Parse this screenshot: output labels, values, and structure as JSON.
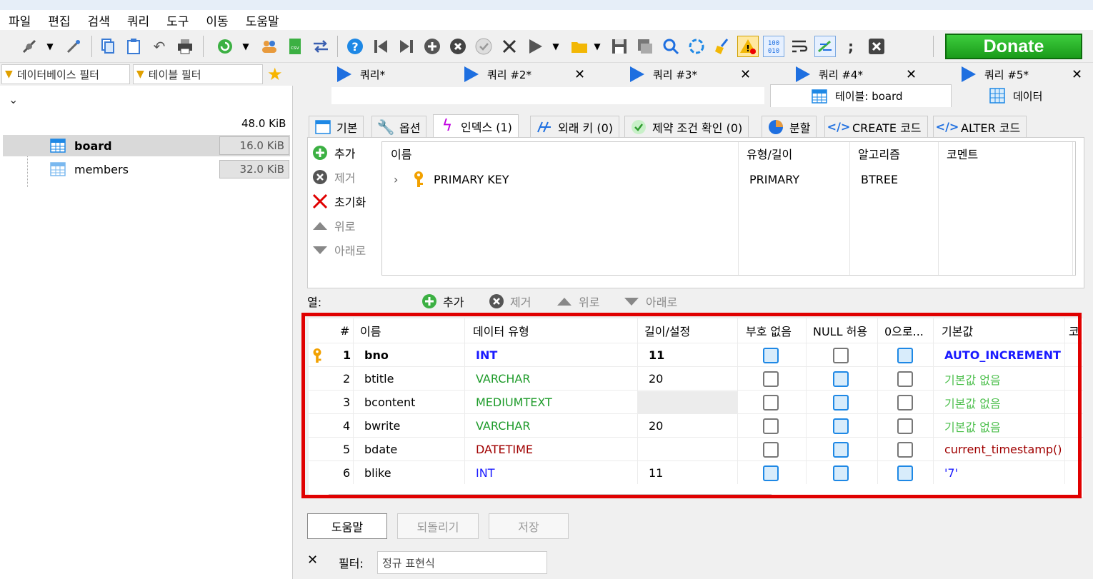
{
  "menu": [
    "파일",
    "편집",
    "검색",
    "쿼리",
    "도구",
    "이동",
    "도움말"
  ],
  "donate_label": "Donate",
  "left": {
    "db_filter_placeholder": "데이터베이스 필터",
    "table_filter_placeholder": "테이블 필터",
    "total_size": "48.0 KiB",
    "tables": [
      {
        "name": "board",
        "size": "16.0 KiB",
        "selected": true
      },
      {
        "name": "members",
        "size": "32.0 KiB",
        "selected": false
      }
    ]
  },
  "query_tabs": [
    "쿼리*",
    "쿼리 #2*",
    "쿼리 #3*",
    "쿼리 #4*",
    "쿼리 #5*"
  ],
  "sub_tabs": {
    "table": "테이블: board",
    "data": "데이터"
  },
  "editor_tabs": [
    "기본",
    "옵션",
    "인덱스 (1)",
    "외래 키 (0)",
    "제약 조건 확인 (0)",
    "분할",
    "CREATE 코드",
    "ALTER 코드"
  ],
  "index_buttons": {
    "add": "추가",
    "remove": "제거",
    "reset": "초기화",
    "up": "위로",
    "down": "아래로"
  },
  "index_grid": {
    "headers": [
      "이름",
      "유형/길이",
      "알고리즘",
      "코멘트"
    ],
    "rows": [
      {
        "name": "PRIMARY KEY",
        "type": "PRIMARY",
        "algo": "BTREE",
        "comment": ""
      }
    ]
  },
  "columns_bar": {
    "label": "열:",
    "add": "추가",
    "remove": "제거",
    "up": "위로",
    "down": "아래로"
  },
  "columns_grid": {
    "headers": [
      "#",
      "이름",
      "데이터 유형",
      "길이/설정",
      "부호 없음",
      "NULL 허용",
      "0으로...",
      "기본값",
      "코"
    ],
    "rows": [
      {
        "num": "1",
        "name": "bno",
        "type": "INT",
        "len": "11",
        "unsigned": true,
        "nullable": false,
        "zerofill": true,
        "default": "AUTO_INCREMENT",
        "pk": true
      },
      {
        "num": "2",
        "name": "btitle",
        "type": "VARCHAR",
        "len": "20",
        "unsigned": false,
        "nullable": true,
        "zerofill": false,
        "default": "기본값 없음",
        "pk": false
      },
      {
        "num": "3",
        "name": "bcontent",
        "type": "MEDIUMTEXT",
        "len": "",
        "unsigned": false,
        "nullable": true,
        "zerofill": false,
        "default": "기본값 없음",
        "pk": false
      },
      {
        "num": "4",
        "name": "bwrite",
        "type": "VARCHAR",
        "len": "20",
        "unsigned": false,
        "nullable": true,
        "zerofill": false,
        "default": "기본값 없음",
        "pk": false
      },
      {
        "num": "5",
        "name": "bdate",
        "type": "DATETIME",
        "len": "",
        "unsigned": false,
        "nullable": true,
        "zerofill": false,
        "default": "current_timestamp()",
        "pk": false
      },
      {
        "num": "6",
        "name": "blike",
        "type": "INT",
        "len": "11",
        "unsigned": true,
        "nullable": true,
        "zerofill": true,
        "default": "'7'",
        "pk": false
      }
    ]
  },
  "bottom_buttons": {
    "help": "도움말",
    "revert": "되돌리기",
    "save": "저장"
  },
  "filter": {
    "close": "✕",
    "label": "필터:",
    "placeholder": "정규 표현식"
  },
  "colors": {
    "type_int": "#1a1aff",
    "type_text": "#1e9b2a",
    "type_date": "#a00000",
    "default_none": "#4cbf4c",
    "default_auto": "#1a1aff",
    "default_func": "#a00000",
    "highlight": "#e00000"
  }
}
